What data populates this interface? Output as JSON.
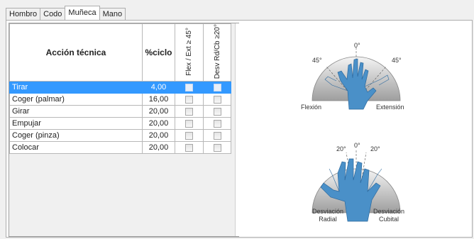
{
  "tabs": [
    {
      "label": "Hombro"
    },
    {
      "label": "Codo"
    },
    {
      "label": "Muñeca"
    },
    {
      "label": "Mano"
    }
  ],
  "grid": {
    "headers": {
      "action": "Acción técnica",
      "cycle": "%ciclo",
      "flex": "Flex / Ext ≥ 45°",
      "desv": "Desv Rd/Cb ≥20°"
    },
    "rows": [
      {
        "action": "Tirar",
        "cycle": "4,00",
        "flex": false,
        "desv": false,
        "selected": true
      },
      {
        "action": "Coger (palmar)",
        "cycle": "16,00",
        "flex": false,
        "desv": false,
        "selected": false
      },
      {
        "action": "Girar",
        "cycle": "20,00",
        "flex": false,
        "desv": false,
        "selected": false
      },
      {
        "action": "Empujar",
        "cycle": "20,00",
        "flex": false,
        "desv": false,
        "selected": false
      },
      {
        "action": "Coger (pinza)",
        "cycle": "20,00",
        "flex": false,
        "desv": false,
        "selected": false
      },
      {
        "action": "Colocar",
        "cycle": "20,00",
        "flex": false,
        "desv": false,
        "selected": false
      }
    ]
  },
  "illustration": {
    "top": {
      "angle_center": "0°",
      "angle_left": "45°",
      "angle_right": "45°",
      "label_left": "Flexión",
      "label_right": "Extensión"
    },
    "bottom": {
      "angle_center": "0°",
      "angle_left": "20°",
      "angle_right": "20°",
      "label_left_1": "Desviación",
      "label_left_2": "Radial",
      "label_right_1": "Desviación",
      "label_right_2": "Cubital"
    }
  },
  "colors": {
    "selection": "#3399ff",
    "hand": "#4a90c8",
    "arc_fill": "#9e9e9e"
  }
}
